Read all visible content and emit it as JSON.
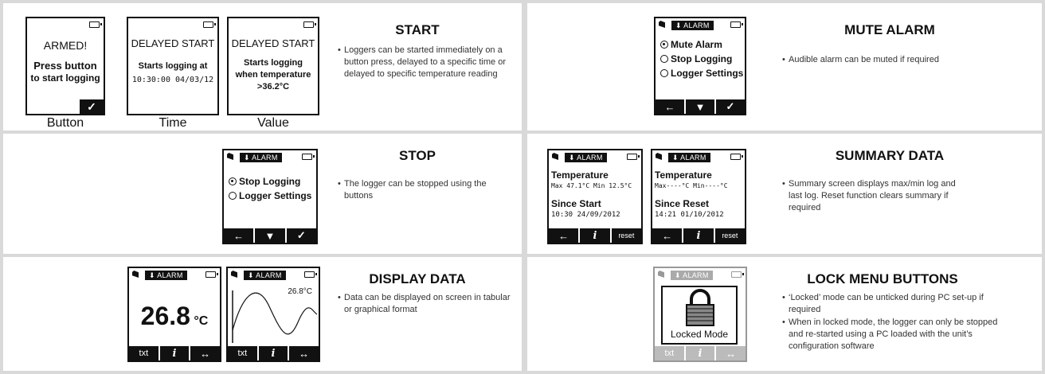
{
  "start": {
    "title": "START",
    "bullets": [
      "Loggers can be started immediately on a button press, delayed to a specific time or delayed to specific temperature reading"
    ],
    "screens": [
      {
        "line1": "ARMED!",
        "line2": "Press button",
        "line3": "to start logging",
        "softkey": "✓",
        "label": "Button"
      },
      {
        "line1": "DELAYED START",
        "line2": "Starts logging at",
        "line3": "10:30:00  04/03/12",
        "label": "Time"
      },
      {
        "line1": "DELAYED START",
        "line2": "Starts logging",
        "line3": "when temperature",
        "line4": ">36.2°C",
        "label": "Value"
      }
    ]
  },
  "mute": {
    "title": "MUTE ALARM",
    "bullets": [
      "Audible alarm can be muted if required"
    ],
    "alarm_badge": "⬇ ALARM",
    "options": [
      "Mute Alarm",
      "Stop Logging",
      "Logger Settings"
    ],
    "softkeys": [
      "←",
      "▼",
      "✓"
    ]
  },
  "stop": {
    "title": "STOP",
    "bullets": [
      "The logger can be stopped using the buttons"
    ],
    "alarm_badge": "⬇ ALARM",
    "options": [
      "Stop Logging",
      "Logger Settings"
    ],
    "softkeys": [
      "←",
      "▼",
      "✓"
    ]
  },
  "summary": {
    "title": "SUMMARY DATA",
    "bullets": [
      "Summary screen displays max/min log and last log. Reset function clears summary if required"
    ],
    "alarm_badge": "⬇ ALARM",
    "screens": [
      {
        "heading": "Temperature",
        "stats": "Max 47.1°C  Min 12.5°C",
        "sub_heading": "Since Start",
        "date": "10:30  24/09/2012"
      },
      {
        "heading": "Temperature",
        "stats": "Max----°C  Min----°C",
        "sub_heading": "Since Reset",
        "date": "14:21  01/10/2012"
      }
    ],
    "softkeys": [
      "←",
      "i",
      "reset"
    ]
  },
  "display": {
    "title": "DISPLAY DATA",
    "bullets": [
      "Data can be displayed on screen in tabular or graphical format"
    ],
    "alarm_badge": "⬇ ALARM",
    "big_value": "26.8",
    "big_unit": "°C",
    "graph_value": "26.8°C",
    "softkeys": [
      "txt",
      "i",
      "↔"
    ]
  },
  "lock": {
    "title": "LOCK MENU BUTTONS",
    "bullets": [
      "‘Locked’ mode can be unticked during PC set-up if required",
      "When in locked mode, the logger can only be stopped and re-started using  a PC loaded with the unit’s configuration software"
    ],
    "alarm_badge": "⬇ ALARM",
    "locked_label": "Locked Mode",
    "softkeys": [
      "txt",
      "i",
      "↔"
    ]
  }
}
